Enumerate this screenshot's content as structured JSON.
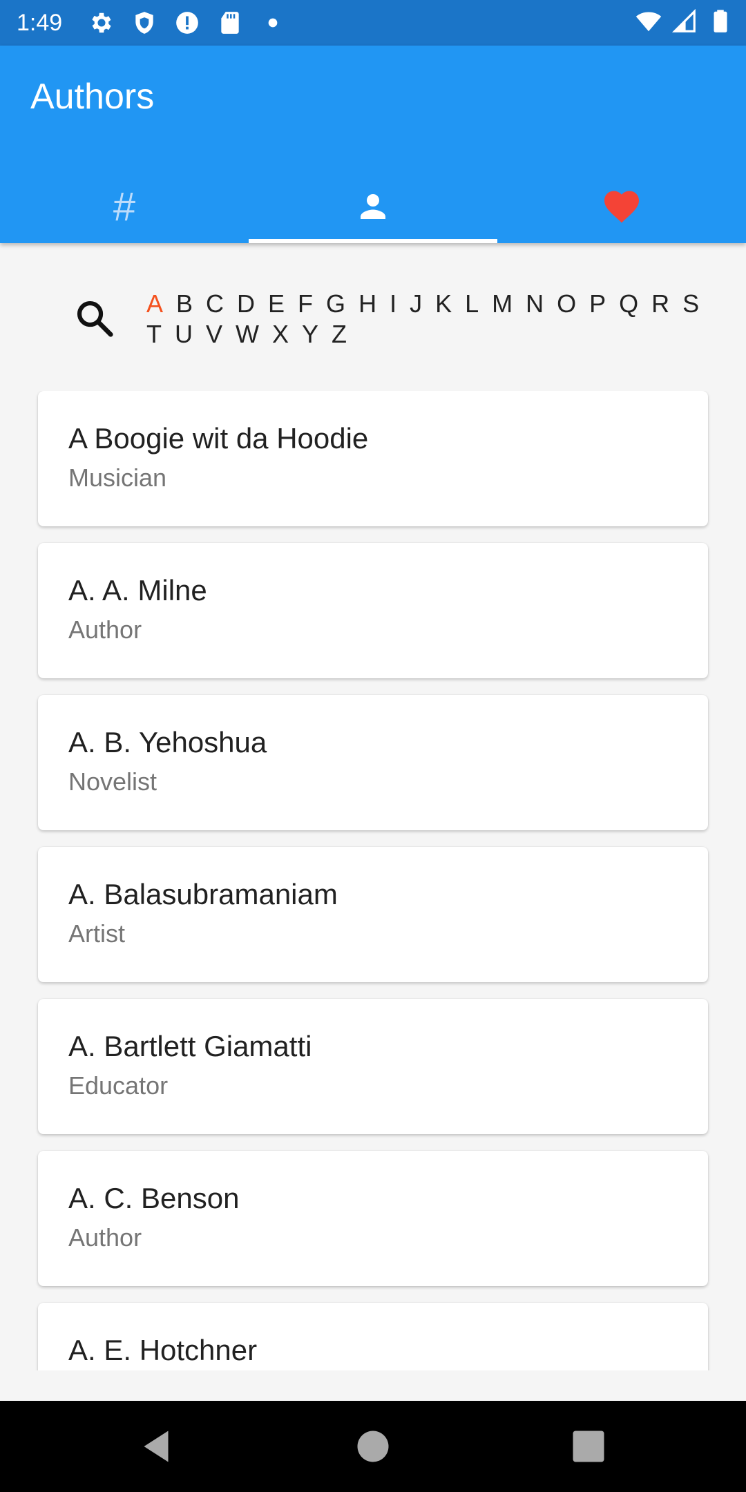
{
  "status_bar": {
    "time": "1:49",
    "left_icons": [
      "gear-icon",
      "shield-icon",
      "alert-icon",
      "sd-card-icon",
      "dot-icon"
    ],
    "right_icons": [
      "wifi-icon",
      "signal-icon",
      "battery-icon"
    ]
  },
  "app_bar": {
    "title": "Authors",
    "tabs": [
      {
        "label": "#",
        "icon": "hash-icon",
        "selected": false
      },
      {
        "label": "",
        "icon": "person-icon",
        "selected": true
      },
      {
        "label": "",
        "icon": "heart-icon",
        "selected": false
      }
    ],
    "colors": {
      "primary": "#2196f3",
      "status": "#1b75c8",
      "heart": "#f44336"
    }
  },
  "alphabet": {
    "search_icon": "search-icon",
    "selected": "A",
    "letters": [
      "A",
      "B",
      "C",
      "D",
      "E",
      "F",
      "G",
      "H",
      "I",
      "J",
      "K",
      "L",
      "M",
      "N",
      "O",
      "P",
      "Q",
      "R",
      "S",
      "T",
      "U",
      "V",
      "W",
      "X",
      "Y",
      "Z"
    ],
    "active_color": "#f4511e"
  },
  "authors": [
    {
      "name": "A Boogie wit da Hoodie",
      "role": "Musician"
    },
    {
      "name": "A. A. Milne",
      "role": "Author"
    },
    {
      "name": "A. B. Yehoshua",
      "role": "Novelist"
    },
    {
      "name": "A. Balasubramaniam",
      "role": "Artist"
    },
    {
      "name": "A. Bartlett Giamatti",
      "role": "Educator"
    },
    {
      "name": "A. C. Benson",
      "role": "Author"
    },
    {
      "name": "A. E. Hotchner",
      "role": ""
    }
  ],
  "nav_bar": {
    "buttons": [
      "back-icon",
      "home-icon",
      "recents-icon"
    ]
  }
}
